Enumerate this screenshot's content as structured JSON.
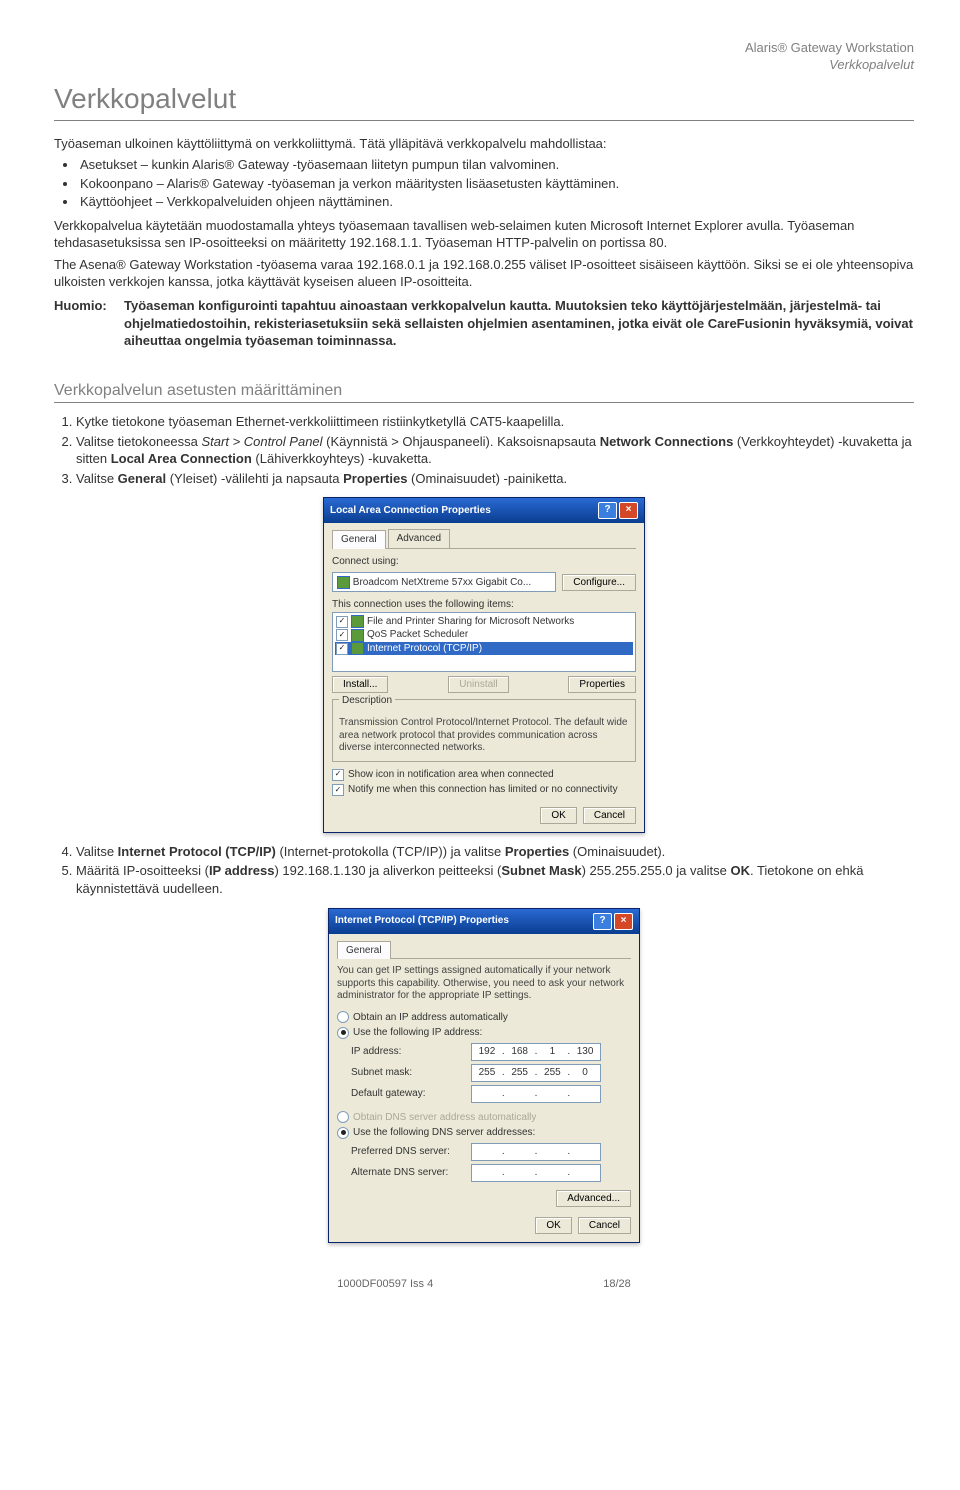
{
  "header": {
    "product": "Alaris® Gateway Workstation",
    "context": "Verkkopalvelut"
  },
  "title": "Verkkopalvelut",
  "intro": "Työaseman ulkoinen käyttöliittymä on verkkoliittymä. Tätä ylläpitävä verkkopalvelu mahdollistaa:",
  "bullets": [
    "Asetukset – kunkin Alaris® Gateway -työasemaan liitetyn pumpun tilan valvominen.",
    "Kokoonpano – Alaris® Gateway -työaseman ja verkon määritysten lisäasetusten käyttäminen.",
    "Käyttöohjeet – Verkkopalveluiden ohjeen näyttäminen."
  ],
  "para1": "Verkkopalvelua käytetään muodostamalla yhteys työasemaan tavallisen web-selaimen kuten Microsoft Internet Explorer avulla. Työaseman tehdasasetuksissa sen IP-osoitteeksi on määritetty 192.168.1.1. Työaseman HTTP-palvelin on portissa 80.",
  "para2": "The Asena® Gateway Workstation -työasema varaa 192.168.0.1 ja 192.168.0.255 väliset IP-osoitteet sisäiseen käyttöön. Siksi se ei ole yhteensopiva ulkoisten verkkojen kanssa, jotka käyttävät kyseisen alueen IP-osoitteita.",
  "huomio": {
    "label": "Huomio:",
    "text": "Työaseman konfigurointi tapahtuu ainoastaan verkkopalvelun kautta. Muutoksien teko käyttöjärjestelmään, järjestelmä- tai ohjelmatiedostoihin, rekisteriasetuksiin sekä sellaisten ohjelmien asentaminen, jotka eivät ole CareFusionin hyväksymiä, voivat aiheuttaa ongelmia työaseman toiminnassa."
  },
  "sub": "Verkkopalvelun asetusten määrittäminen",
  "steps_a": [
    "Kytke tietokone työaseman Ethernet-verkkoliittimeen ristiinkytketyllä CAT5-kaapelilla.",
    "Valitse tietokoneessa <i>Start > Control Panel</i> (Käynnistä > Ohjauspaneeli). Kaksoisnapsauta <b>Network Connections</b> (Verkkoyhteydet) -kuvaketta ja sitten <b>Local Area Connection</b> (Lähiverkkoyhteys) -kuvaketta.",
    "Valitse <b>General</b> (Yleiset) -välilehti ja napsauta <b>Properties</b> (Ominaisuudet) -painiketta."
  ],
  "dlg1": {
    "title": "Local Area Connection Properties",
    "tab_general": "General",
    "tab_advanced": "Advanced",
    "connect_using": "Connect using:",
    "adapter": "Broadcom NetXtreme 57xx Gigabit Co...",
    "configure": "Configure...",
    "uses_items": "This connection uses the following items:",
    "item1": "File and Printer Sharing for Microsoft Networks",
    "item2": "QoS Packet Scheduler",
    "item3": "Internet Protocol (TCP/IP)",
    "install": "Install...",
    "uninstall": "Uninstall",
    "properties": "Properties",
    "desc_legend": "Description",
    "desc": "Transmission Control Protocol/Internet Protocol. The default wide area network protocol that provides communication across diverse interconnected networks.",
    "chk1": "Show icon in notification area when connected",
    "chk2": "Notify me when this connection has limited or no connectivity",
    "ok": "OK",
    "cancel": "Cancel"
  },
  "steps_b": [
    "Valitse <b>Internet Protocol (TCP/IP)</b> (Internet-protokolla (TCP/IP)) ja valitse <b>Properties</b> (Ominaisuudet).",
    "Määritä IP-osoitteeksi (<b>IP address</b>) 192.168.1.130 ja aliverkon peitteeksi (<b>Subnet Mask</b>) 255.255.255.0 ja valitse <b>OK</b>. Tietokone on ehkä käynnistettävä uudelleen."
  ],
  "dlg2": {
    "title": "Internet Protocol (TCP/IP) Properties",
    "tab_general": "General",
    "intro": "You can get IP settings assigned automatically if your network supports this capability. Otherwise, you need to ask your network administrator for the appropriate IP settings.",
    "r1": "Obtain an IP address automatically",
    "r2": "Use the following IP address:",
    "ip_lbl": "IP address:",
    "mask_lbl": "Subnet mask:",
    "gw_lbl": "Default gateway:",
    "r3": "Obtain DNS server address automatically",
    "r4": "Use the following DNS server addresses:",
    "pdns": "Preferred DNS server:",
    "adns": "Alternate DNS server:",
    "adv": "Advanced...",
    "ok": "OK",
    "cancel": "Cancel",
    "ip": [
      "192",
      "168",
      "1",
      "130"
    ],
    "mask": [
      "255",
      "255",
      "255",
      "0"
    ]
  },
  "footer": {
    "left": "1000DF00597 Iss 4",
    "right": "18/28"
  }
}
